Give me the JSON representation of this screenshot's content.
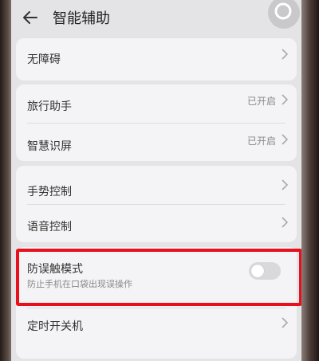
{
  "header": {
    "title": "智能辅助"
  },
  "items": [
    {
      "label": "无障碍"
    },
    {
      "label": "旅行助手",
      "status": "已开启"
    },
    {
      "label": "智慧识屏",
      "status": "已开启"
    },
    {
      "label": "手势控制"
    },
    {
      "label": "语音控制"
    },
    {
      "label": "防误触模式",
      "sublabel": "防止手机在口袋出现误操作",
      "toggle": "off"
    },
    {
      "label": "定时开关机"
    }
  ],
  "colors": {
    "highlight": "#e8101c",
    "background": "#e4e3e5",
    "card": "#f4f3f5"
  }
}
